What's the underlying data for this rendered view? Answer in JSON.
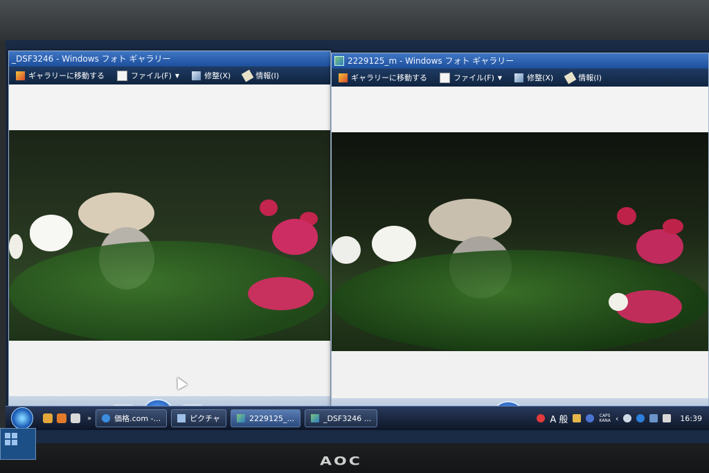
{
  "monitor": {
    "brand": "AOC"
  },
  "left_window": {
    "title": "_DSF3246 - Windows フォト ギャラリー",
    "menu": [
      "ギャラリーに移動する",
      "ファイル(F)",
      "修整(X)",
      "情報(I)"
    ]
  },
  "right_window": {
    "title": "2229125_m - Windows フォト ギャラリー",
    "menu": [
      "ギャラリーに移動する",
      "ファイル(F)",
      "修整(X)",
      "情報(I)"
    ]
  },
  "taskbar": {
    "tasks": [
      "価格.com -...",
      "ピクチャ",
      "2229125_...",
      "_DSF3246 ..."
    ],
    "ime": "A 般",
    "caps": "CAPS",
    "kana": "KANA",
    "clock": "16:39"
  },
  "icons": {
    "zoom": "zoom-icon",
    "fit": "fit-icon",
    "prev": "previous-icon",
    "slideshow": "slideshow-icon",
    "next": "next-icon",
    "rotate_ccw": "rotate-left-icon",
    "rotate_cw": "rotate-right-icon",
    "delete": "delete-icon"
  }
}
